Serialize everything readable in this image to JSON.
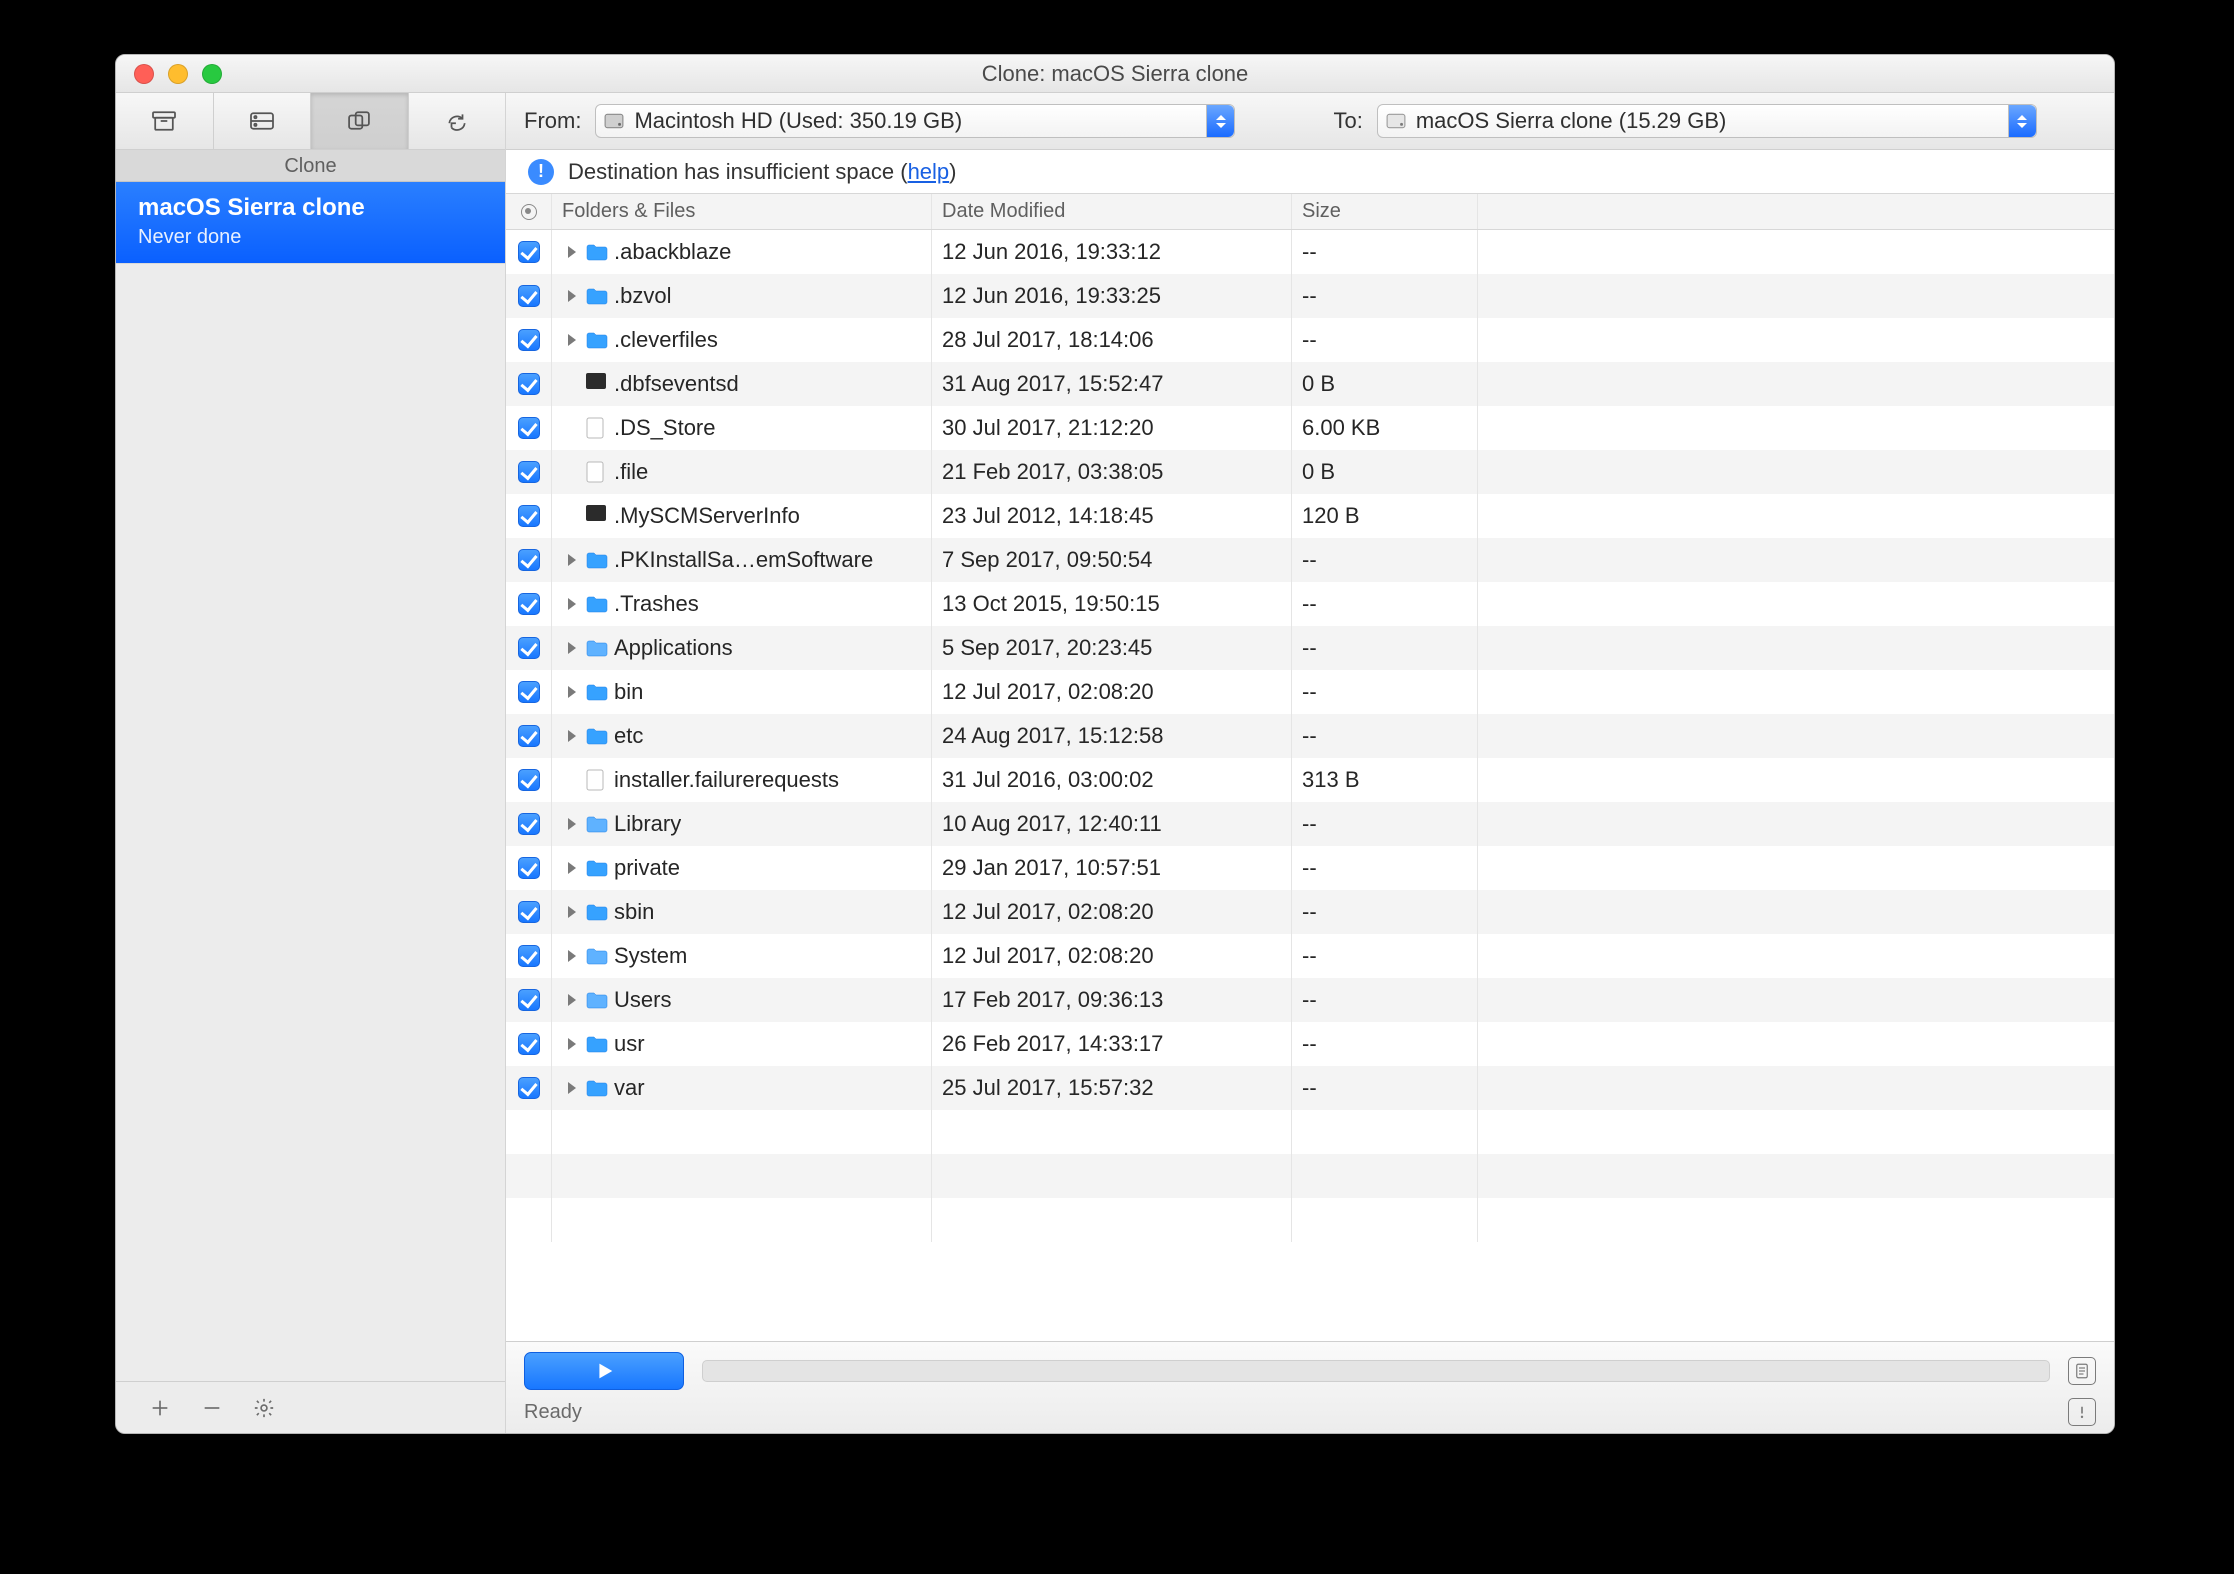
{
  "window": {
    "title": "Clone: macOS Sierra clone"
  },
  "sidebar": {
    "heading": "Clone",
    "tasks": [
      {
        "title": "macOS Sierra clone",
        "sub": "Never done",
        "selected": true
      }
    ],
    "footer_icons": [
      "plus-icon",
      "minus-icon",
      "gear-icon"
    ]
  },
  "selectors": {
    "from_label": "From:",
    "from_value": "Macintosh HD (Used: 350.19 GB)",
    "to_label": "To:",
    "to_value": "macOS Sierra clone (15.29 GB)"
  },
  "warning": {
    "text_before": "Destination has insufficient space (",
    "link": "help",
    "text_after": ")"
  },
  "columns": {
    "name": "Folders & Files",
    "date": "Date Modified",
    "size": "Size"
  },
  "rows": [
    {
      "kind": "folder",
      "name": ".abackblaze",
      "date": "12 Jun 2016, 19:33:12",
      "size": "--"
    },
    {
      "kind": "folder",
      "name": ".bzvol",
      "date": "12 Jun 2016, 19:33:25",
      "size": "--"
    },
    {
      "kind": "folder",
      "name": ".cleverfiles",
      "date": "28 Jul 2017, 18:14:06",
      "size": "--"
    },
    {
      "kind": "exec",
      "name": ".dbfseventsd",
      "date": "31 Aug 2017, 15:52:47",
      "size": "0 B"
    },
    {
      "kind": "file",
      "name": ".DS_Store",
      "date": "30 Jul 2017, 21:12:20",
      "size": "6.00 KB"
    },
    {
      "kind": "file",
      "name": ".file",
      "date": "21 Feb 2017, 03:38:05",
      "size": "0 B"
    },
    {
      "kind": "exec",
      "name": ".MySCMServerInfo",
      "date": "23 Jul 2012, 14:18:45",
      "size": "120 B"
    },
    {
      "kind": "folder",
      "name": ".PKInstallSa…emSoftware",
      "date": "7 Sep 2017, 09:50:54",
      "size": "--"
    },
    {
      "kind": "folder",
      "name": ".Trashes",
      "date": "13 Oct 2015, 19:50:15",
      "size": "--"
    },
    {
      "kind": "folder-special",
      "name": "Applications",
      "date": "5 Sep 2017, 20:23:45",
      "size": "--"
    },
    {
      "kind": "folder",
      "name": "bin",
      "date": "12 Jul 2017, 02:08:20",
      "size": "--"
    },
    {
      "kind": "folder",
      "name": "etc",
      "date": "24 Aug 2017, 15:12:58",
      "size": "--"
    },
    {
      "kind": "file",
      "name": "installer.failurerequests",
      "date": "31 Jul 2016, 03:00:02",
      "size": "313 B"
    },
    {
      "kind": "folder-special",
      "name": "Library",
      "date": "10 Aug 2017, 12:40:11",
      "size": "--"
    },
    {
      "kind": "folder",
      "name": "private",
      "date": "29 Jan 2017, 10:57:51",
      "size": "--"
    },
    {
      "kind": "folder",
      "name": "sbin",
      "date": "12 Jul 2017, 02:08:20",
      "size": "--"
    },
    {
      "kind": "folder-special",
      "name": "System",
      "date": "12 Jul 2017, 02:08:20",
      "size": "--"
    },
    {
      "kind": "folder-special",
      "name": "Users",
      "date": "17 Feb 2017, 09:36:13",
      "size": "--"
    },
    {
      "kind": "folder",
      "name": "usr",
      "date": "26 Feb 2017, 14:33:17",
      "size": "--"
    },
    {
      "kind": "folder",
      "name": "var",
      "date": "25 Jul 2017, 15:57:32",
      "size": "--"
    }
  ],
  "empty_rows": 3,
  "footer": {
    "status": "Ready"
  }
}
